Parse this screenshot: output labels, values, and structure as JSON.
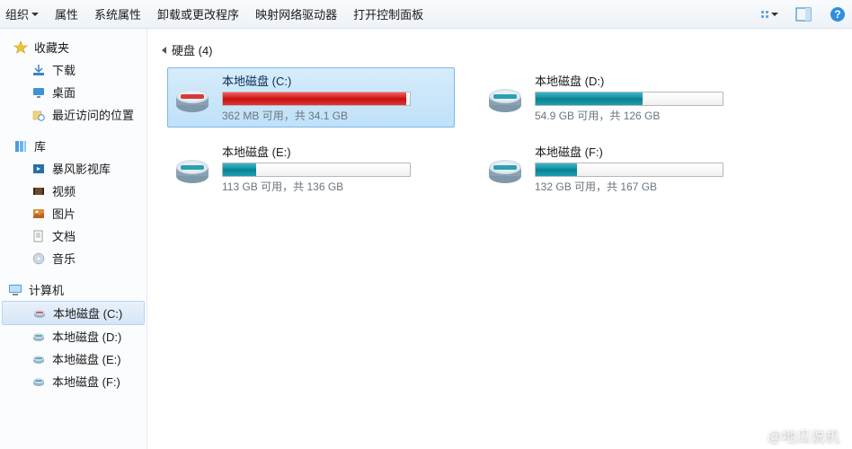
{
  "toolbar": {
    "organize": "组织",
    "properties": "属性",
    "system_properties": "系统属性",
    "uninstall_change": "卸载或更改程序",
    "map_network": "映射网络驱动器",
    "open_control_panel": "打开控制面板"
  },
  "sidebar": {
    "favorites": {
      "label": "收藏夹",
      "items": [
        {
          "label": "下载"
        },
        {
          "label": "桌面"
        },
        {
          "label": "最近访问的位置"
        }
      ]
    },
    "libraries": {
      "label": "库",
      "items": [
        {
          "label": "暴风影视库"
        },
        {
          "label": "视频"
        },
        {
          "label": "图片"
        },
        {
          "label": "文档"
        },
        {
          "label": "音乐"
        }
      ]
    },
    "computer": {
      "label": "计算机",
      "items": [
        {
          "label": "本地磁盘 (C:)"
        },
        {
          "label": "本地磁盘 (D:)"
        },
        {
          "label": "本地磁盘 (E:)"
        },
        {
          "label": "本地磁盘 (F:)"
        }
      ]
    }
  },
  "main": {
    "section_title": "硬盘 (4)",
    "drives": [
      {
        "name": "本地磁盘 (C:)",
        "sub": "362 MB 可用，共 34.1 GB",
        "fill_pct": 98,
        "color": "red",
        "selected": true
      },
      {
        "name": "本地磁盘 (D:)",
        "sub": "54.9 GB 可用，共 126 GB",
        "fill_pct": 57,
        "color": "teal",
        "selected": false
      },
      {
        "name": "本地磁盘 (E:)",
        "sub": "113 GB 可用，共 136 GB",
        "fill_pct": 18,
        "color": "teal",
        "selected": false
      },
      {
        "name": "本地磁盘 (F:)",
        "sub": "132 GB 可用，共 167 GB",
        "fill_pct": 22,
        "color": "teal",
        "selected": false
      }
    ]
  },
  "watermark": "@地瓜说机"
}
